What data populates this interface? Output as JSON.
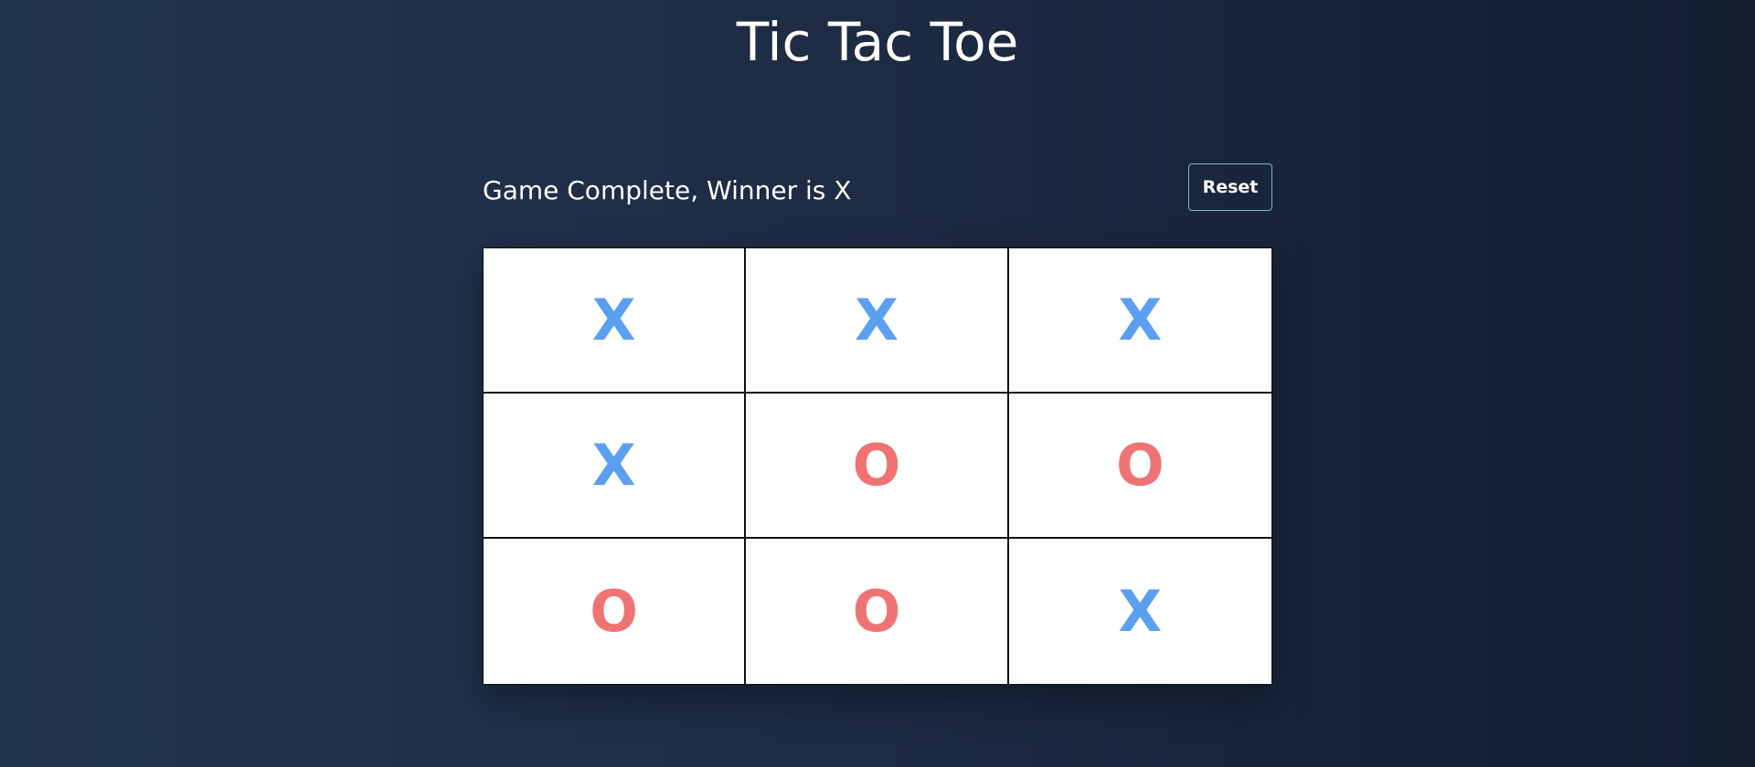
{
  "header": {
    "title": "Tic Tac Toe"
  },
  "game": {
    "status": "Game Complete, Winner is X",
    "reset_label": "Reset",
    "board": [
      [
        "X",
        "X",
        "X"
      ],
      [
        "X",
        "O",
        "O"
      ],
      [
        "O",
        "O",
        "X"
      ]
    ]
  },
  "colors": {
    "x": "#5b9ff0",
    "o": "#f07373",
    "background_start": "#22354f",
    "background_end": "#141d30"
  }
}
